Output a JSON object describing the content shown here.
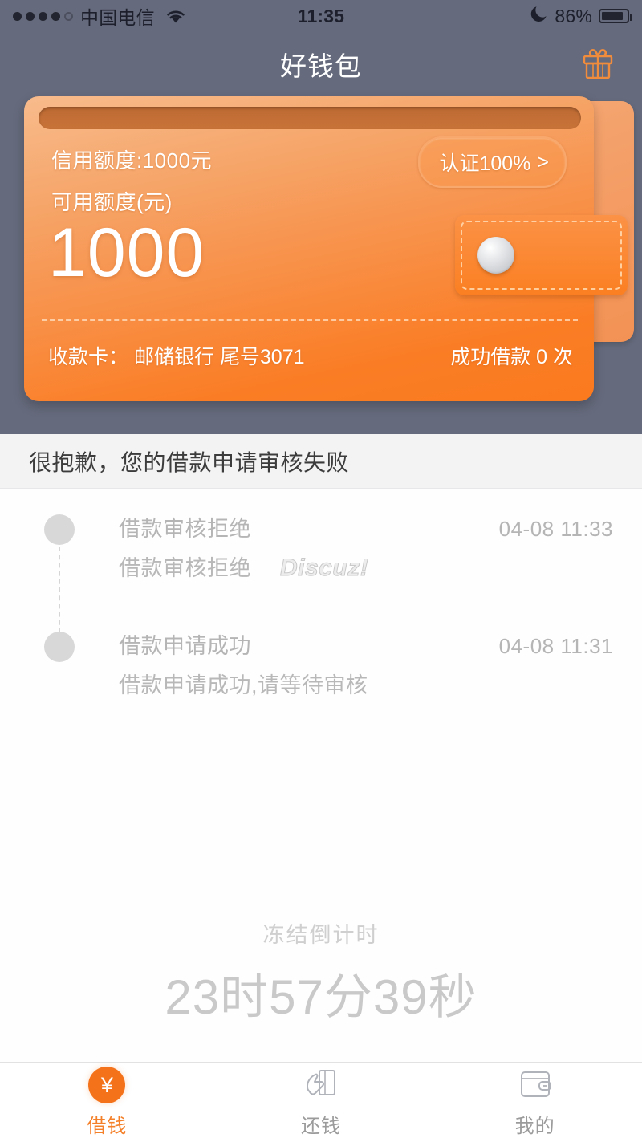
{
  "status_bar": {
    "carrier": "中国电信",
    "time": "11:35",
    "battery_percent": "86%",
    "signal_dots_filled": 4,
    "signal_dots_total": 5,
    "wifi_icon": "wifi-icon",
    "moon_icon": "moon-dnd-icon",
    "battery_icon": "battery-icon"
  },
  "nav": {
    "title": "好钱包",
    "gift_icon": "gift-icon"
  },
  "card": {
    "credit_limit_text": "信用额度:1000元",
    "available_label": "可用额度(元)",
    "available_amount": "1000",
    "verify_label": "认证100%",
    "verify_chevron": ">",
    "bank_card_text": "收款卡： 邮储银行 尾号3071",
    "loan_count_text": "成功借款 0 次",
    "clasp_icon": "wallet-clasp-icon",
    "accent_color": "#fb7a1e",
    "card_light_color": "#f8bb8c"
  },
  "notice": {
    "text": "很抱歉，您的借款申请审核失败"
  },
  "timeline": {
    "items": [
      {
        "title": "借款审核拒绝",
        "desc": "借款审核拒绝",
        "watermark": "Discuz!",
        "time": "04-08 11:33"
      },
      {
        "title": "借款申请成功",
        "desc": "借款申请成功,请等待审核",
        "watermark": "",
        "time": "04-08 11:31"
      }
    ]
  },
  "countdown": {
    "label": "冻结倒计时",
    "value": "23时57分39秒"
  },
  "tab_bar": {
    "tabs": [
      {
        "label": "借钱",
        "icon": "yen-coin-icon",
        "active": true
      },
      {
        "label": "还钱",
        "icon": "hand-money-icon",
        "active": false
      },
      {
        "label": "我的",
        "icon": "wallet-icon",
        "active": false
      }
    ],
    "active_color": "#f4802a",
    "inactive_color": "#9b9b9b"
  }
}
